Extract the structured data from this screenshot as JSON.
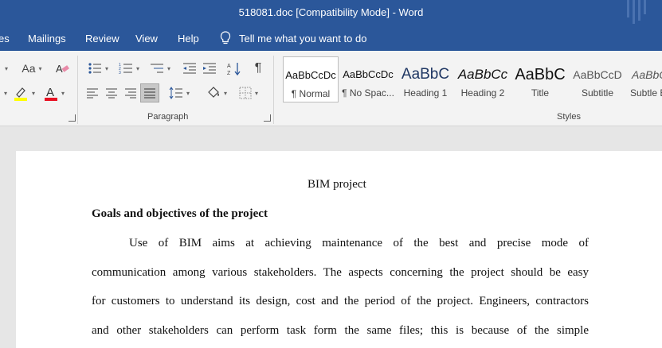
{
  "window": {
    "title": "518081.doc [Compatibility Mode]  -  Word"
  },
  "tabs": [
    "es",
    "Mailings",
    "Review",
    "View",
    "Help"
  ],
  "tell_me": {
    "placeholder": "Tell me what you want to do",
    "icon": "lightbulb-icon"
  },
  "ribbon": {
    "font_group": {
      "aa_label": "Aa",
      "highlight_color": "#ffff00",
      "font_color": "#e81123"
    },
    "paragraph_group": {
      "label": "Paragraph",
      "pilcrow": "¶"
    },
    "styles_group": {
      "label": "Styles",
      "items": [
        {
          "sample": "AaBbCcDc",
          "label": "¶ Normal",
          "selected": true
        },
        {
          "sample": "AaBbCcDc",
          "label": "¶ No Spac..."
        },
        {
          "sample": "AaBbC",
          "label": "Heading 1"
        },
        {
          "sample": "AaBbCc",
          "label": "Heading 2"
        },
        {
          "sample": "AaBbC",
          "label": "Title"
        },
        {
          "sample": "AaBbCcD",
          "label": "Subtitle"
        },
        {
          "sample": "AaBbC",
          "label": "Subtle E"
        }
      ]
    }
  },
  "document": {
    "title": "BIM project",
    "heading": "Goals and objectives of the project",
    "lines": [
      "Use of BIM aims at achieving maintenance of the best and precise mode of",
      "communication among various stakeholders. The aspects concerning the project should be easy",
      "for customers to understand its design, cost and the period of the project. Engineers, contractors",
      "and other stakeholders can perform task form the same files; this is because of the simple"
    ]
  }
}
